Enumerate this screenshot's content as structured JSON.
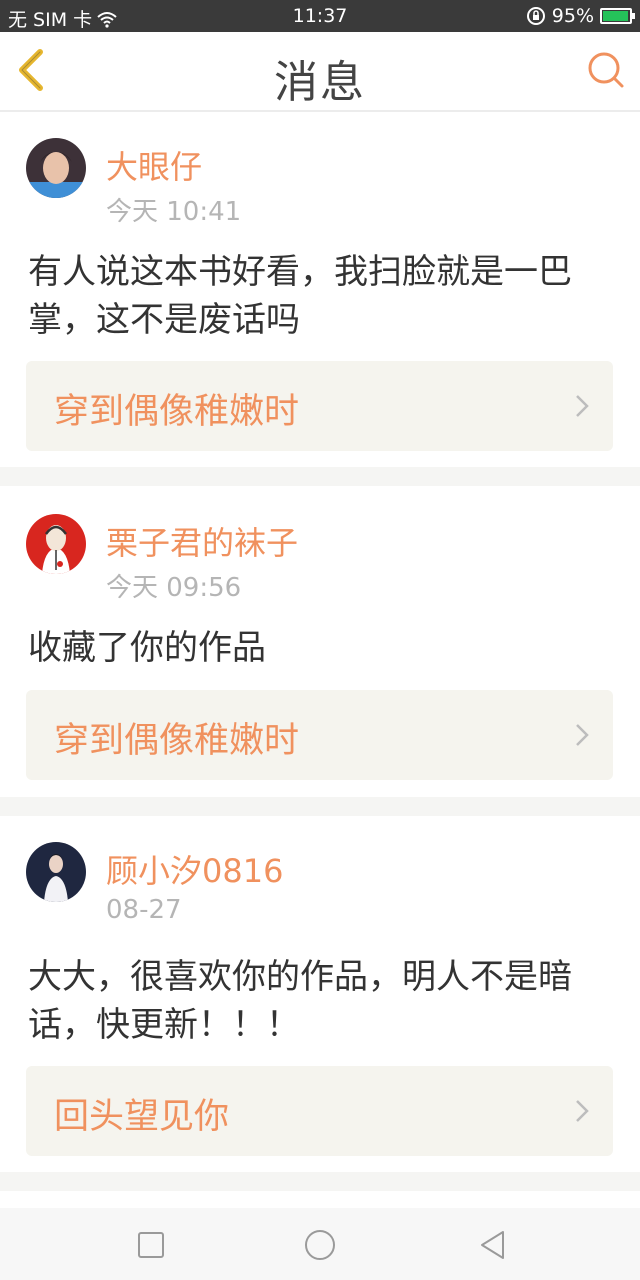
{
  "status_bar": {
    "carrier": "无 SIM 卡",
    "time": "11:37",
    "battery": "95%",
    "battery_level": 0.95
  },
  "header": {
    "title": "消息",
    "back_icon": "chevron-left-icon",
    "search_icon": "search-icon"
  },
  "messages": [
    {
      "username": "大眼仔",
      "time": "今天 10:41",
      "text": "有人说这本书好看，我扫脸就是一巴掌，这不是废话吗",
      "work_title": "穿到偶像稚嫩时"
    },
    {
      "username": "栗子君的袜子",
      "time": "今天 09:56",
      "text": "收藏了你的作品",
      "work_title": "穿到偶像稚嫩时"
    },
    {
      "username": "顾小汐0816",
      "time": "08-27",
      "text": "大大，很喜欢你的作品，明人不是暗话，快更新！！！",
      "work_title": "回头望见你"
    }
  ],
  "colors": {
    "accent": "#f0915e",
    "back_icon": "#e6b62e",
    "work_link_bg": "#f5f4ee",
    "separator": "#f5f5f3"
  }
}
